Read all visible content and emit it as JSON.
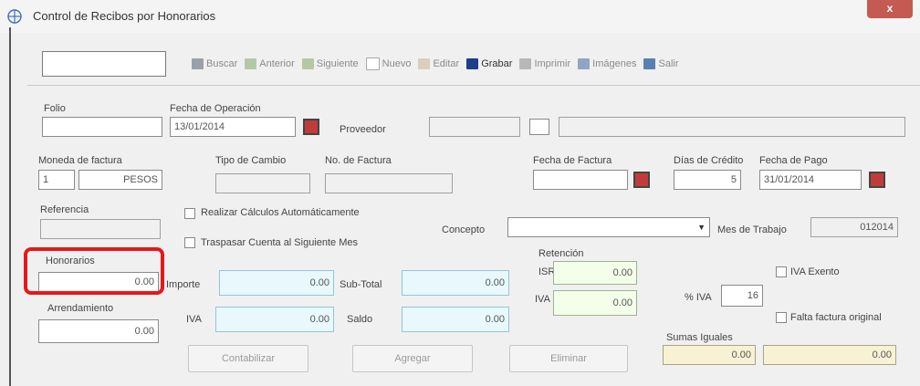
{
  "window": {
    "title": "Control de Recibos por Honorarios",
    "close_label": "x"
  },
  "toolbar": {
    "items": [
      {
        "label": "Buscar",
        "icon": "binoculars-icon"
      },
      {
        "label": "Anterior",
        "icon": "arrow-left-icon"
      },
      {
        "label": "Siguiente",
        "icon": "arrow-right-icon"
      },
      {
        "label": "Nuevo",
        "icon": "new-document-icon"
      },
      {
        "label": "Editar",
        "icon": "edit-icon"
      },
      {
        "label": "Grabar",
        "icon": "save-icon"
      },
      {
        "label": "Imprimir",
        "icon": "print-icon"
      },
      {
        "label": "Imágenes",
        "icon": "images-icon"
      },
      {
        "label": "Salir",
        "icon": "exit-icon"
      }
    ]
  },
  "form": {
    "folio_label": "Folio",
    "fecha_operacion_label": "Fecha de Operación",
    "fecha_operacion_value": "13/01/2014",
    "proveedor_label": "Proveedor",
    "moneda_label": "Moneda de factura",
    "moneda_code": "1",
    "moneda_name": "PESOS",
    "tipo_cambio_label": "Tipo de Cambio",
    "no_factura_label": "No. de Factura",
    "fecha_factura_label": "Fecha de Factura",
    "dias_credito_label": "Días de Crédito",
    "dias_credito_value": "5",
    "fecha_pago_label": "Fecha de Pago",
    "fecha_pago_value": "31/01/2014",
    "referencia_label": "Referencia",
    "realizar_calculos_label": "Realizar Cálculos Automáticamente",
    "traspasar_label": "Traspasar Cuenta al Siguiente Mes",
    "concepto_label": "Concepto",
    "mes_trabajo_label": "Mes de Trabajo",
    "mes_trabajo_value": "012014",
    "honorarios_label": "Honorarios",
    "honorarios_value": "0.00",
    "importe_label": "Importe",
    "importe_value": "0.00",
    "subtotal_label": "Sub-Total",
    "subtotal_value": "0.00",
    "retencion_label": "Retención",
    "isr_label": "ISR",
    "isr_value": "0.00",
    "iva_ret_label": "IVA",
    "iva_ret_value": "0.00",
    "iva_exento_label": "IVA Exento",
    "pct_iva_label": "% IVA",
    "pct_iva_value": "16",
    "arrendamiento_label": "Arrendamiento",
    "arrendamiento_value": "0.00",
    "iva_label": "IVA",
    "iva_value": "0.00",
    "saldo_label": "Saldo",
    "saldo_value": "0.00",
    "falta_factura_label": "Falta factura original",
    "sumas_iguales_label": "Sumas Iguales",
    "suma_1": "0.00",
    "suma_2": "0.00"
  },
  "buttons": {
    "contabilizar": "Contabilizar",
    "agregar": "Agregar",
    "eliminar": "Eliminar"
  },
  "colors": {
    "highlight": "#e8161b",
    "close": "#c45a52",
    "field_cyan": "#e8f8fc",
    "field_green": "#f4ffea",
    "field_khaki": "#f7f2d4"
  }
}
